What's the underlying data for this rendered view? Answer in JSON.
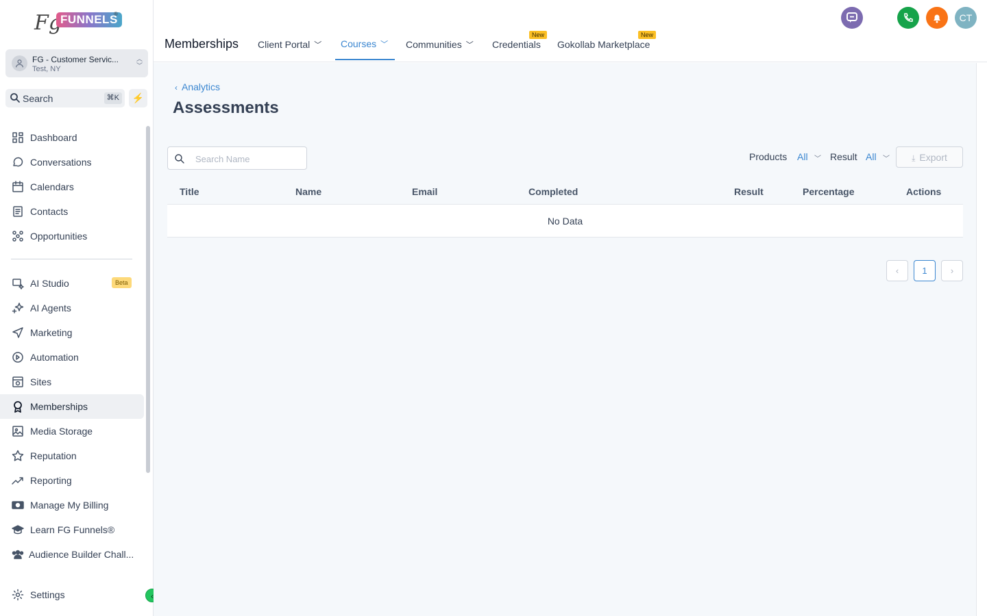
{
  "logo": {
    "fg": "Fg",
    "funnels": "FUNNELS",
    "reg": "®"
  },
  "account": {
    "name": "FG - Customer Servic...",
    "location": "Test, NY"
  },
  "search": {
    "label": "Search",
    "shortcut": "⌘K"
  },
  "sidebar": {
    "items": [
      {
        "label": "Dashboard",
        "icon": "dashboard-icon"
      },
      {
        "label": "Conversations",
        "icon": "chat-icon"
      },
      {
        "label": "Calendars",
        "icon": "calendar-icon"
      },
      {
        "label": "Contacts",
        "icon": "contacts-icon"
      },
      {
        "label": "Opportunities",
        "icon": "opportunities-icon"
      }
    ],
    "items2": [
      {
        "label": "AI Studio",
        "icon": "ai-studio-icon",
        "badge": "Beta"
      },
      {
        "label": "AI Agents",
        "icon": "sparkle-icon"
      },
      {
        "label": "Marketing",
        "icon": "send-icon"
      },
      {
        "label": "Automation",
        "icon": "automation-icon"
      },
      {
        "label": "Sites",
        "icon": "sites-icon"
      },
      {
        "label": "Memberships",
        "icon": "award-icon",
        "active": true
      },
      {
        "label": "Media Storage",
        "icon": "image-icon"
      },
      {
        "label": "Reputation",
        "icon": "star-icon"
      },
      {
        "label": "Reporting",
        "icon": "trend-icon"
      },
      {
        "label": "Manage My Billing",
        "icon": "billing-icon"
      },
      {
        "label": "Learn FG Funnels®",
        "icon": "graduation-icon"
      },
      {
        "label": "Audience Builder Chall...",
        "icon": "users-icon"
      }
    ],
    "settings": "Settings"
  },
  "topbar": {
    "title": "Memberships",
    "tabs": [
      {
        "label": "Client Portal",
        "dropdown": true
      },
      {
        "label": "Courses",
        "dropdown": true,
        "selected": true
      },
      {
        "label": "Communities",
        "dropdown": true
      },
      {
        "label": "Credentials",
        "badge": "New"
      },
      {
        "label": "Gokollab Marketplace",
        "badge": "New"
      }
    ],
    "avatar": "CT"
  },
  "page": {
    "back": "Analytics",
    "title": "Assessments",
    "search_placeholder": "Search Name",
    "filters": {
      "products_label": "Products",
      "products_value": "All",
      "result_label": "Result",
      "result_value": "All"
    },
    "export": "Export",
    "table": {
      "columns": [
        "Title",
        "Name",
        "Email",
        "Completed",
        "Result",
        "Percentage",
        "Actions"
      ],
      "empty": "No Data"
    },
    "pagination": {
      "current": "1",
      "prev": "‹",
      "next": "›"
    }
  },
  "colors": {
    "accent": "#3a86d0",
    "phone": "#16a34a",
    "bell": "#f97316",
    "avatar": "#7fb3c2",
    "chat": "#7c6bb0"
  }
}
